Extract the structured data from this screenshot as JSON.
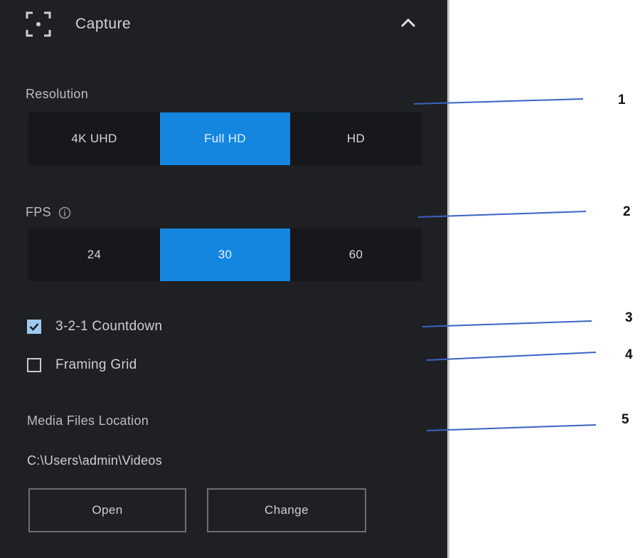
{
  "header": {
    "title": "Capture",
    "icon": "capture-icon",
    "collapse_icon": "chevron-up-icon"
  },
  "resolution": {
    "label": "Resolution",
    "options": [
      "4K UHD",
      "Full HD",
      "HD"
    ],
    "selected": "Full HD"
  },
  "fps": {
    "label": "FPS",
    "info_icon": "info-icon",
    "options": [
      "24",
      "30",
      "60"
    ],
    "selected": "30"
  },
  "countdown": {
    "label": "3-2-1 Countdown",
    "checked": true
  },
  "framing_grid": {
    "label": "Framing Grid",
    "checked": false
  },
  "media": {
    "label": "Media Files Location",
    "path": "C:\\Users\\admin\\Videos",
    "open_label": "Open",
    "change_label": "Change"
  },
  "callouts": [
    "1",
    "2",
    "3",
    "4",
    "5"
  ],
  "colors": {
    "panel_bg": "#1e2024",
    "accent": "#1486e0",
    "callout_line": "#3a63c4"
  }
}
